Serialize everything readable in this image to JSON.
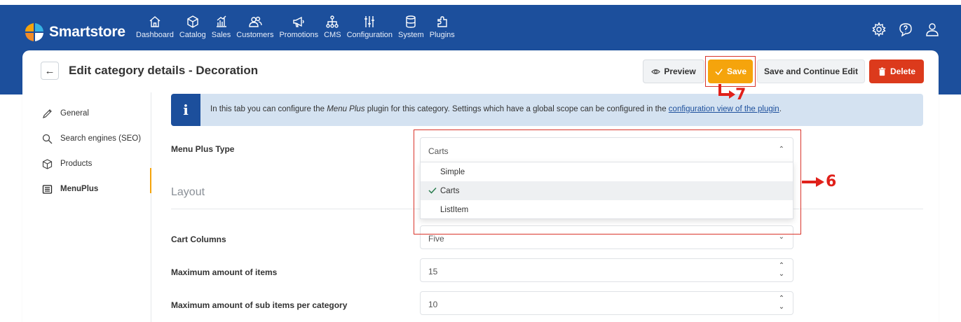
{
  "brand": {
    "name": "Smartstore"
  },
  "nav": [
    {
      "label": "Dashboard",
      "icon": "home-icon"
    },
    {
      "label": "Catalog",
      "icon": "box-icon"
    },
    {
      "label": "Sales",
      "icon": "bar-chart-icon"
    },
    {
      "label": "Customers",
      "icon": "users-icon"
    },
    {
      "label": "Promotions",
      "icon": "megaphone-icon"
    },
    {
      "label": "CMS",
      "icon": "sitemap-icon"
    },
    {
      "label": "Configuration",
      "icon": "sliders-icon"
    },
    {
      "label": "System",
      "icon": "database-icon"
    },
    {
      "label": "Plugins",
      "icon": "puzzle-icon"
    }
  ],
  "header": {
    "title": "Edit category details - Decoration",
    "preview_label": "Preview",
    "save_label": "Save",
    "save_continue_label": "Save and Continue Edit",
    "delete_label": "Delete"
  },
  "sidebar": {
    "items": [
      {
        "label": "General",
        "icon": "pencil-icon"
      },
      {
        "label": "Search engines (SEO)",
        "icon": "search-icon"
      },
      {
        "label": "Products",
        "icon": "cube-icon"
      },
      {
        "label": "MenuPlus",
        "icon": "list-icon"
      }
    ]
  },
  "info": {
    "text_before": "In this tab you can configure the ",
    "plugin_name": "Menu Plus",
    "text_middle": " plugin for this category. Settings which have a global scope can be configured in the ",
    "link_text": "configuration view of the plugin",
    "text_after": "."
  },
  "form": {
    "menu_plus_type_label": "Menu Plus Type",
    "menu_plus_type_value": "Carts",
    "options": [
      "Simple",
      "Carts",
      "ListItem"
    ],
    "selected_option": "Carts",
    "layout_title": "Layout",
    "cart_columns_label": "Cart Columns",
    "cart_columns_value": "Five",
    "max_items_label": "Maximum amount of items",
    "max_items_value": "15",
    "max_sub_items_label": "Maximum amount of sub items per category",
    "max_sub_items_value": "10"
  },
  "annotations": {
    "dropdown_number": "6",
    "save_number": "7",
    "color": "#e0201a"
  },
  "colors": {
    "topbar": "#1c4f9c",
    "save": "#f5a40c",
    "delete": "#dc3a1c",
    "info_bg": "#d4e2f1"
  }
}
